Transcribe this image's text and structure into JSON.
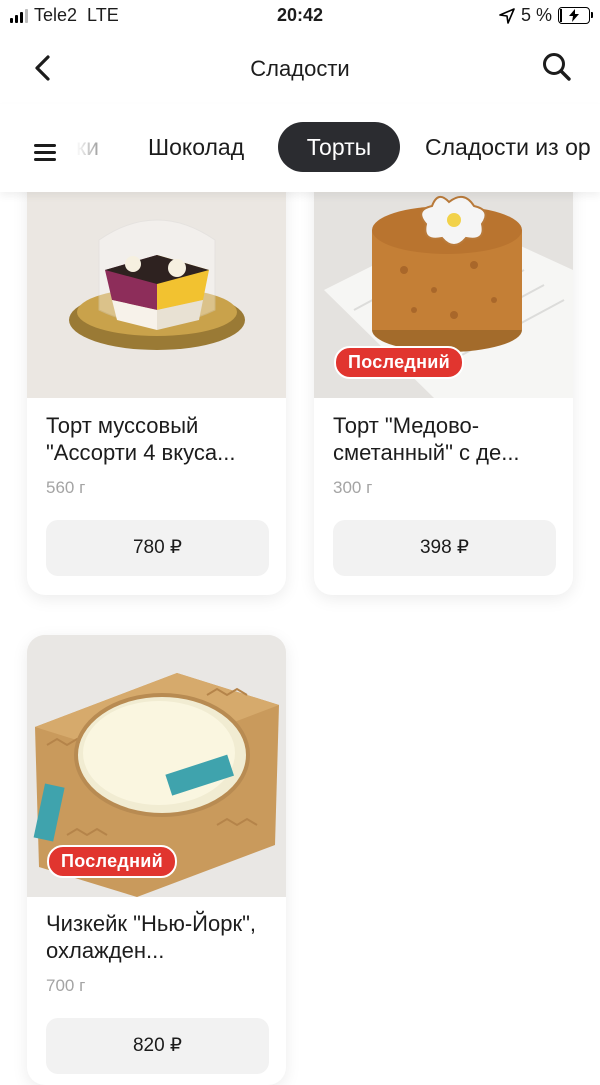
{
  "status_bar": {
    "carrier": "Tele2",
    "network": "LTE",
    "time": "20:42",
    "battery": "5 %"
  },
  "header": {
    "title": "Сладости",
    "back_icon": "chevron-left-icon",
    "search_icon": "search-icon"
  },
  "tabs": {
    "menu_icon": "hamburger-icon",
    "items": [
      {
        "label": "ки",
        "active": false
      },
      {
        "label": "Шоколад",
        "active": false
      },
      {
        "label": "Торты",
        "active": true
      },
      {
        "label": "Сладости из ор",
        "active": false
      }
    ]
  },
  "products": [
    {
      "title": "Торт муссовый \"Ассорти 4 вкуса...",
      "weight": "560 г",
      "price": "780 ₽",
      "badge": ""
    },
    {
      "title": "Торт \"Медово-сметанный\" с де...",
      "weight": "300 г",
      "price": "398 ₽",
      "badge": "Последний"
    },
    {
      "title": "Чизкейк \"Нью-Йорк\", охлажден...",
      "weight": "700 г",
      "price": "820 ₽",
      "badge": "Последний"
    }
  ],
  "colors": {
    "accent_active_tab": "#2b2c30",
    "badge_red": "#e1352f",
    "price_button_bg": "#f2f2f2"
  }
}
